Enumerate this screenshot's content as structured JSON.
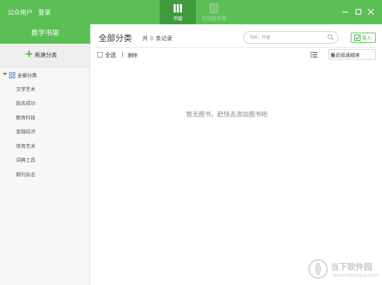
{
  "titlebar": {
    "user": "公众用户",
    "login": "登录",
    "tabs": [
      {
        "label": "书架",
        "icon": "bookshelf-icon",
        "active": true
      },
      {
        "label": "在线图书馆",
        "icon": "online-library-icon",
        "active": false
      }
    ],
    "colors": {
      "bar": "#5cbf56",
      "active_tab": "#3f9b3d"
    }
  },
  "sidebar": {
    "title": "数字书架",
    "new_category": "新建分类",
    "all_category": "全部分类",
    "items": [
      {
        "label": "文学艺术"
      },
      {
        "label": "励志成功"
      },
      {
        "label": "教育科技"
      },
      {
        "label": "金融经济"
      },
      {
        "label": "体育艺术"
      },
      {
        "label": "词典工具"
      },
      {
        "label": "期刊杂志"
      }
    ]
  },
  "main": {
    "title": "全部分类",
    "record_prefix": "共",
    "record_count": "0",
    "record_suffix": "条记录",
    "search_placeholder": "书名，作者",
    "import_label": "导入",
    "select_all": "全选",
    "delete": "删除",
    "sort_selected": "最近阅读顺序",
    "empty_message": "暂无图书，赶快去添加图书吧"
  },
  "watermark": {
    "text": "当下软件园",
    "url": "www.downxia.com"
  }
}
